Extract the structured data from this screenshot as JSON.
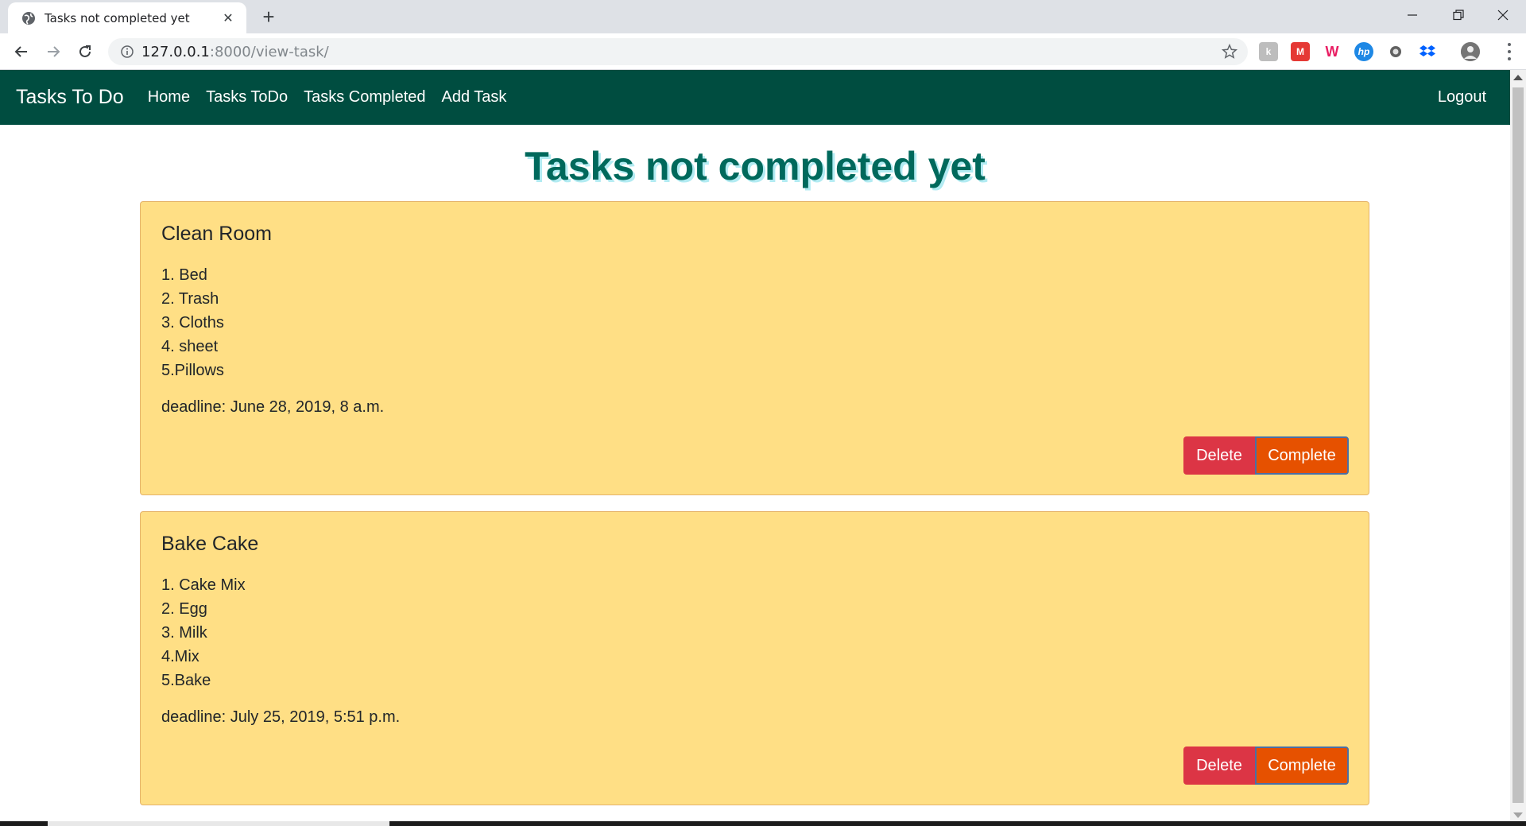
{
  "browser": {
    "tab_title": "Tasks not completed yet",
    "url_host": "127.0.0.1",
    "url_rest": ":8000/view-task/",
    "extensions": [
      "extension-k-icon",
      "extension-red-icon",
      "extension-w-icon",
      "extension-hp-icon",
      "extension-circle-icon",
      "dropbox-icon",
      "profile-avatar"
    ]
  },
  "navbar": {
    "brand": "Tasks To Do",
    "links": [
      "Home",
      "Tasks ToDo",
      "Tasks Completed",
      "Add Task"
    ],
    "logout": "Logout"
  },
  "page": {
    "title": "Tasks not completed yet"
  },
  "tasks": [
    {
      "title": "Clean Room",
      "items": [
        "1. Bed",
        "2. Trash",
        "3. Cloths",
        "4. sheet",
        "5.Pillows"
      ],
      "deadline": "deadline: June 28, 2019, 8 a.m.",
      "delete_label": "Delete",
      "complete_label": "Complete"
    },
    {
      "title": "Bake Cake",
      "items": [
        "1. Cake Mix",
        "2. Egg",
        "3. Milk",
        "4.Mix",
        "5.Bake"
      ],
      "deadline": "deadline: July 25, 2019, 5:51 p.m.",
      "delete_label": "Delete",
      "complete_label": "Complete"
    }
  ],
  "colors": {
    "navbar": "#004d40",
    "title": "#00695c",
    "card": "#ffdf85",
    "delete": "#dc3545",
    "complete": "#e65100"
  }
}
